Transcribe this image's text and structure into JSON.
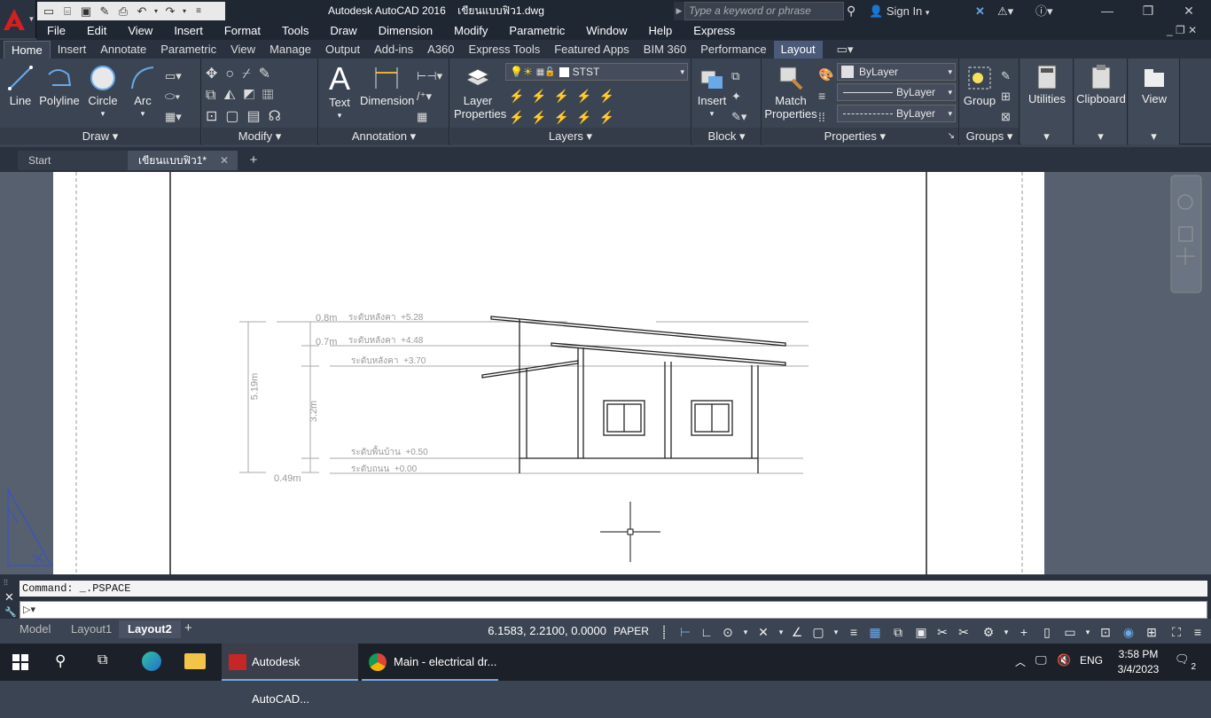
{
  "title_bar": {
    "title": "Autodesk AutoCAD 2016",
    "filename": "เขียนแบบฟิว1.dwg",
    "search_placeholder": "Type a keyword or phrase",
    "sign_in": "Sign In"
  },
  "menu": [
    "File",
    "Edit",
    "View",
    "Insert",
    "Format",
    "Tools",
    "Draw",
    "Dimension",
    "Modify",
    "Parametric",
    "Window",
    "Help",
    "Express"
  ],
  "ribbon_tabs": [
    "Home",
    "Insert",
    "Annotate",
    "Parametric",
    "View",
    "Manage",
    "Output",
    "Add-ins",
    "A360",
    "Express Tools",
    "Featured Apps",
    "BIM 360",
    "Performance",
    "Layout"
  ],
  "ribbon": {
    "draw": {
      "title": "Draw",
      "line": "Line",
      "polyline": "Polyline",
      "circle": "Circle",
      "arc": "Arc"
    },
    "modify": {
      "title": "Modify"
    },
    "annotation": {
      "title": "Annotation",
      "text": "Text",
      "dimension": "Dimension"
    },
    "layers": {
      "title": "Layers",
      "layer_properties_1": "Layer",
      "layer_properties_2": "Properties",
      "current_layer": "STST"
    },
    "block": {
      "title": "Block",
      "insert": "Insert"
    },
    "properties": {
      "title": "Properties",
      "match_1": "Match",
      "match_2": "Properties",
      "color": "ByLayer",
      "linetype": "ByLayer",
      "lineweight": "ByLayer"
    },
    "groups": {
      "title": "Groups",
      "group": "Group"
    },
    "utilities": "Utilities",
    "clipboard": "Clipboard",
    "view": "View"
  },
  "file_tabs": {
    "start": "Start",
    "drawing": "เขียนแบบฟิว1*"
  },
  "drawing": {
    "levels": [
      {
        "label": "ระดับหลังคา",
        "value": "+5.28"
      },
      {
        "label": "ระดับหลังคา",
        "value": "+4.48"
      },
      {
        "label": "ระดับหลังคา",
        "value": "+3.70"
      },
      {
        "label": "ระดับพื้นบ้าน",
        "value": "+0.50"
      },
      {
        "label": "ระดับถนน",
        "value": "+0.00"
      }
    ],
    "dims": {
      "d1": "0.8m",
      "d2": "0.7m",
      "total": "5.19m",
      "wall": "3.2m",
      "base": "0.49m"
    }
  },
  "command": {
    "history": "Command: _.PSPACE",
    "input": ""
  },
  "layout_tabs": [
    "Model",
    "Layout1",
    "Layout2"
  ],
  "status": {
    "coords": "6.1583, 2.2100, 0.0000",
    "space": "PAPER"
  },
  "taskbar": {
    "autocad": "Autodesk AutoCAD...",
    "chrome": "Main - electrical dr...",
    "lang": "ENG",
    "time": "3:58 PM",
    "date": "3/4/2023",
    "notifications": "2"
  }
}
